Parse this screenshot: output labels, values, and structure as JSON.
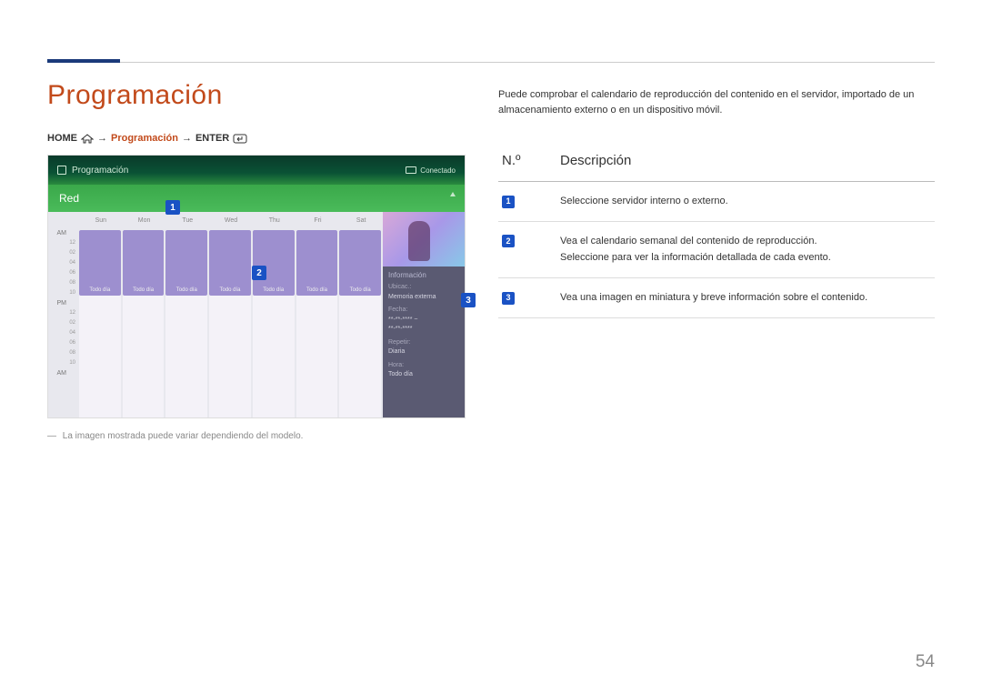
{
  "title": "Programación",
  "breadcrumb": {
    "home": "HOME",
    "arrow": "→",
    "current": "Programación",
    "enter": "ENTER"
  },
  "screenshot": {
    "header_title": "Programación",
    "header_status": "Conectado",
    "server_label": "Red",
    "days": [
      "Sun",
      "Mon",
      "Tue",
      "Wed",
      "Thu",
      "Fri",
      "Sat"
    ],
    "times_am_label": "AM",
    "times_pm_label": "PM",
    "hours": [
      "12",
      "02",
      "04",
      "06",
      "08",
      "10",
      "12",
      "02",
      "04",
      "06",
      "08",
      "10"
    ],
    "am_end": "AM",
    "block_label": "Todo día",
    "info": {
      "title": "Información",
      "loc_label": "Ubicac.:",
      "loc_val": "Memoria externa",
      "date_label": "Fecha:",
      "date_val": "**-**-**** ~",
      "date_val2": "**-**-****",
      "repeat_label": "Repetir:",
      "repeat_val": "Diaria",
      "time_label": "Hora:",
      "time_val": "Todo día"
    }
  },
  "callouts": {
    "1": "1",
    "2": "2",
    "3": "3"
  },
  "caption": "La imagen mostrada puede variar dependiendo del modelo.",
  "intro": "Puede comprobar el calendario de reproducción del contenido en el servidor, importado de un almacenamiento externo o en un dispositivo móvil.",
  "table": {
    "head_num": "N.º",
    "head_desc": "Descripción",
    "rows": [
      {
        "n": "1",
        "text": "Seleccione servidor interno o externo."
      },
      {
        "n": "2",
        "text": "Vea el calendario semanal del contenido de reproducción.\nSeleccione para ver la información detallada de cada evento."
      },
      {
        "n": "3",
        "text": "Vea una imagen en miniatura y breve información sobre el contenido."
      }
    ]
  },
  "page_number": "54"
}
